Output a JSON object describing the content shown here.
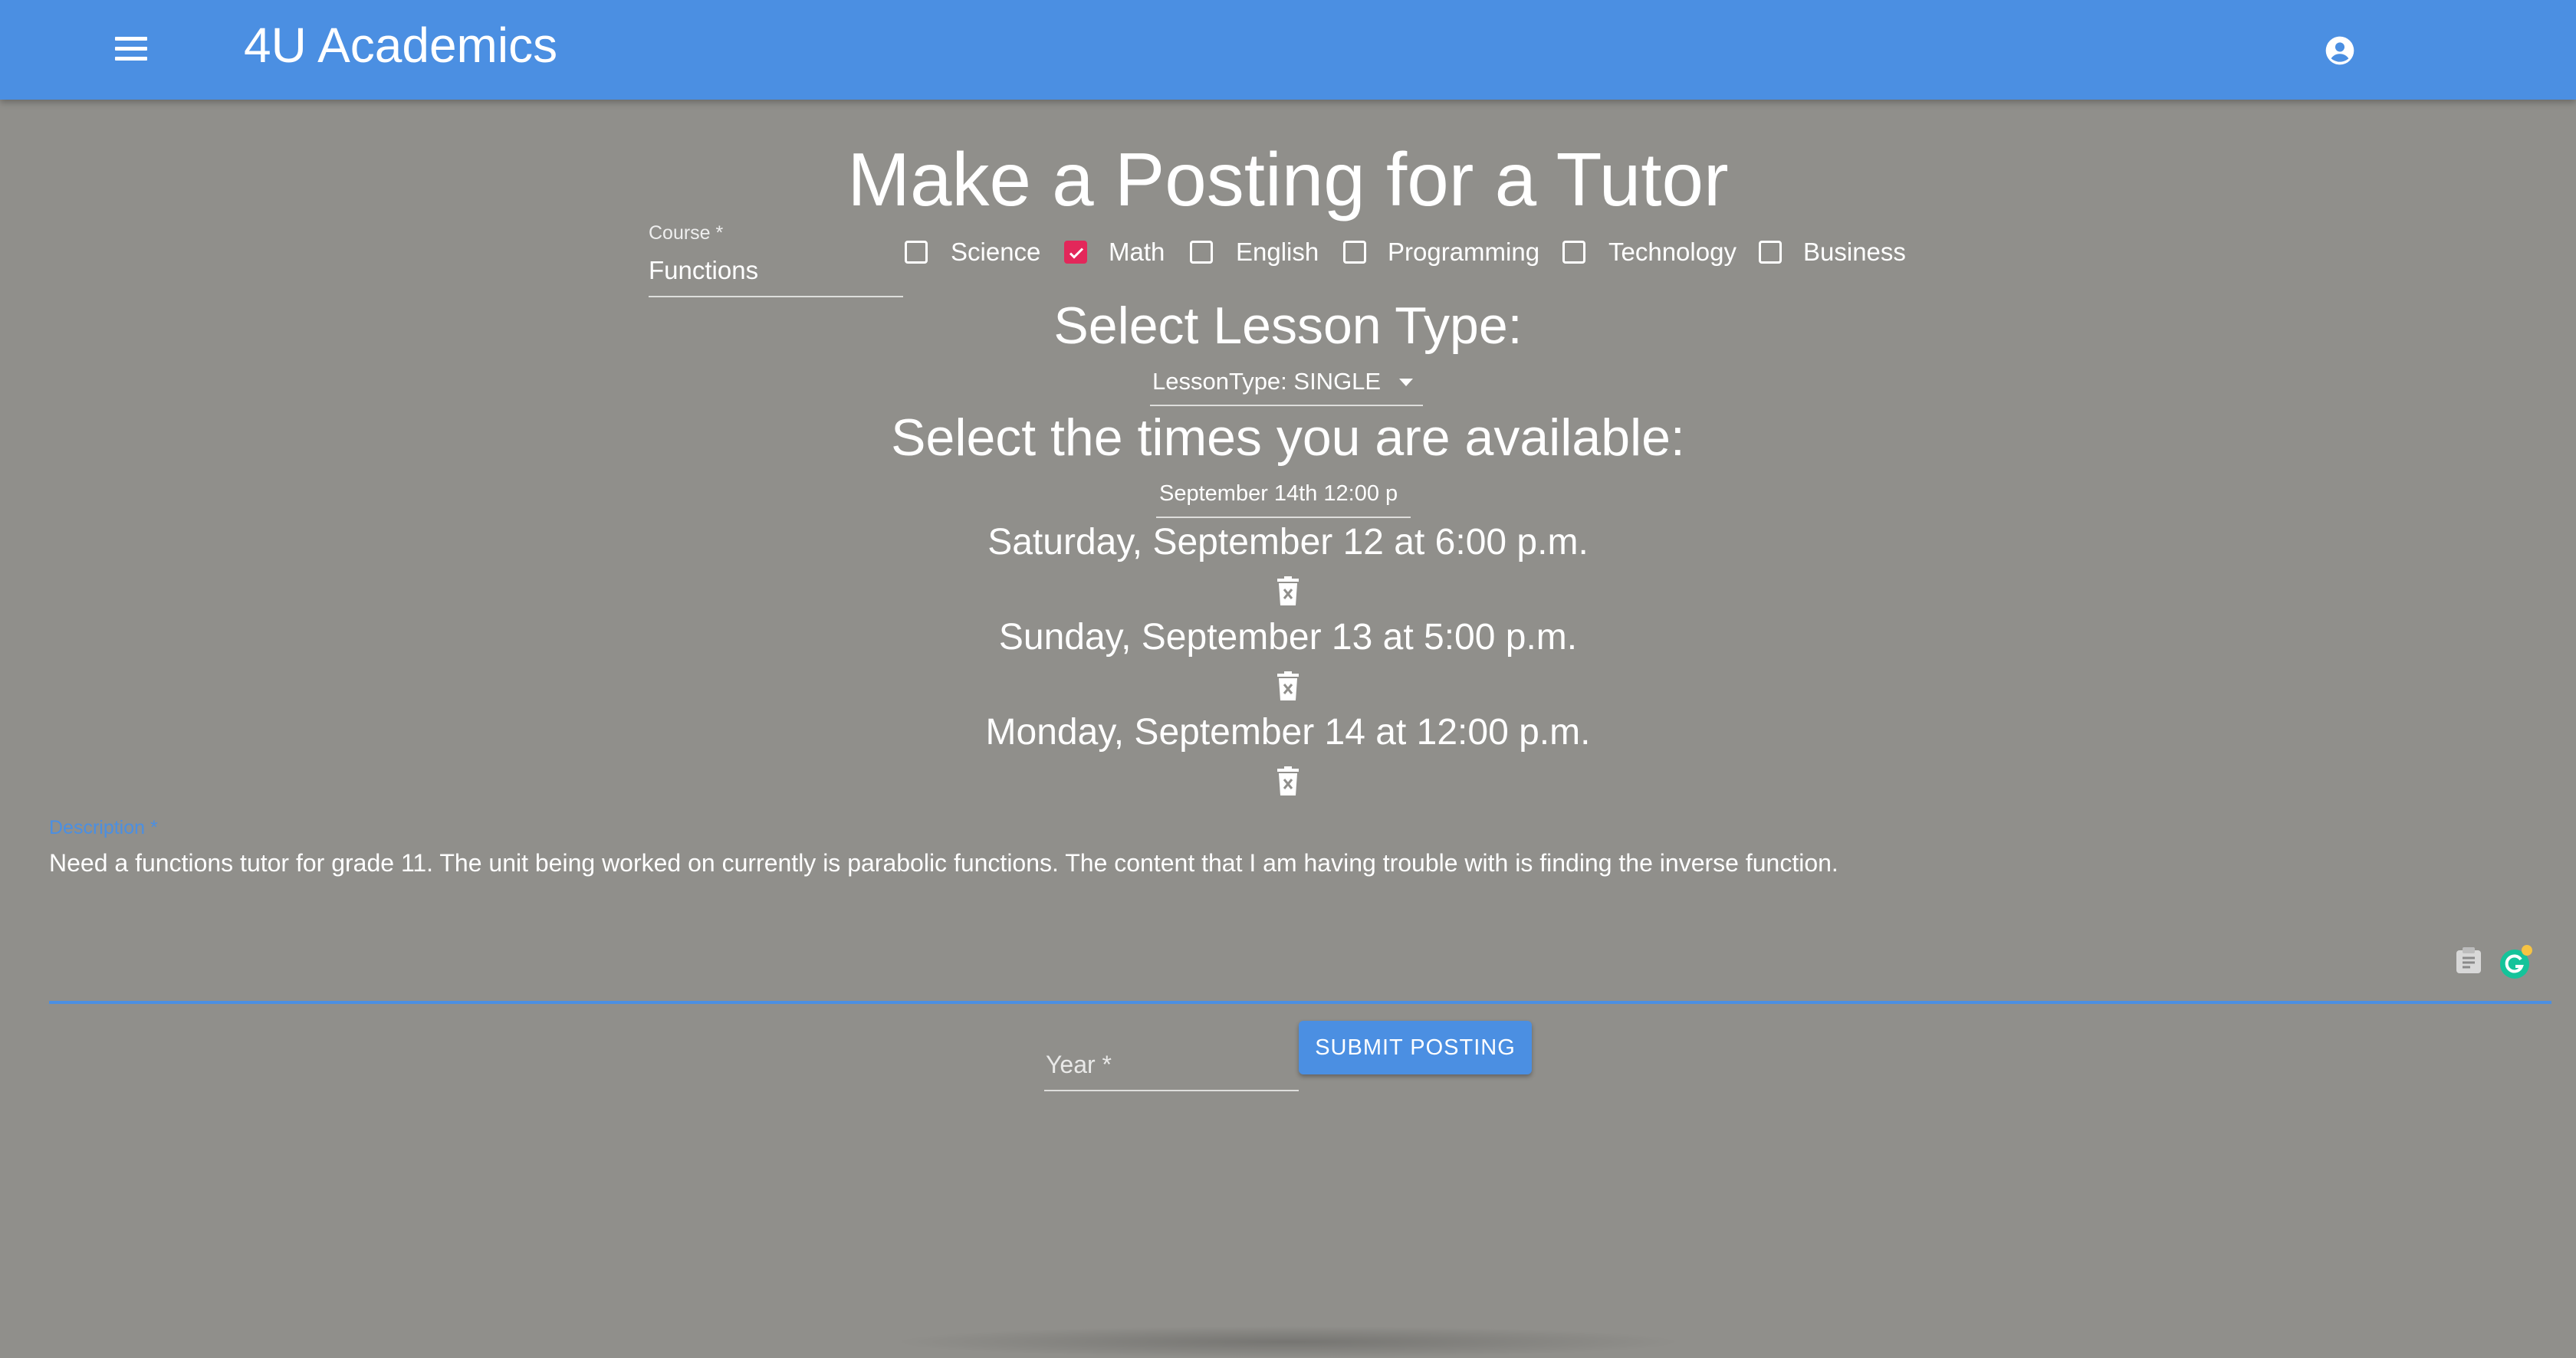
{
  "appbar": {
    "title": "4U Academics",
    "menu_icon": "menu-icon",
    "account_icon": "account-circle-icon",
    "color": "#4b8fe2"
  },
  "page": {
    "title": "Make a Posting for a Tutor",
    "background": "#908f8b"
  },
  "course": {
    "label": "Course *",
    "value": "Functions"
  },
  "categories": [
    {
      "label": "Science",
      "checked": false
    },
    {
      "label": "Math",
      "checked": true
    },
    {
      "label": "English",
      "checked": false
    },
    {
      "label": "Programming",
      "checked": false
    },
    {
      "label": "Technology",
      "checked": false
    },
    {
      "label": "Business",
      "checked": false
    }
  ],
  "lesson": {
    "heading": "Select Lesson Type:",
    "select_value": "LessonType: SINGLE"
  },
  "times": {
    "heading": "Select the times you are available:",
    "input_value": "September 14th 12:00 p",
    "slots": [
      {
        "label": "Saturday, September 12 at 6:00 p.m.",
        "delete_icon": "delete-forever-icon"
      },
      {
        "label": "Sunday, September 13 at 5:00 p.m.",
        "delete_icon": "delete-forever-icon"
      },
      {
        "label": "Monday, September 14 at 12:00 p.m.",
        "delete_icon": "delete-forever-icon"
      }
    ]
  },
  "description": {
    "label": "Description *",
    "value": "Need a functions tutor for grade 11. The unit being worked on currently is parabolic functions. The content that I am having trouble with is finding the inverse function."
  },
  "year": {
    "placeholder": "Year *",
    "value": ""
  },
  "submit": {
    "label": "SUBMIT POSTING"
  },
  "accent_colors": {
    "primary": "#4b8fe2",
    "checkbox_checked": "#e3275a"
  }
}
